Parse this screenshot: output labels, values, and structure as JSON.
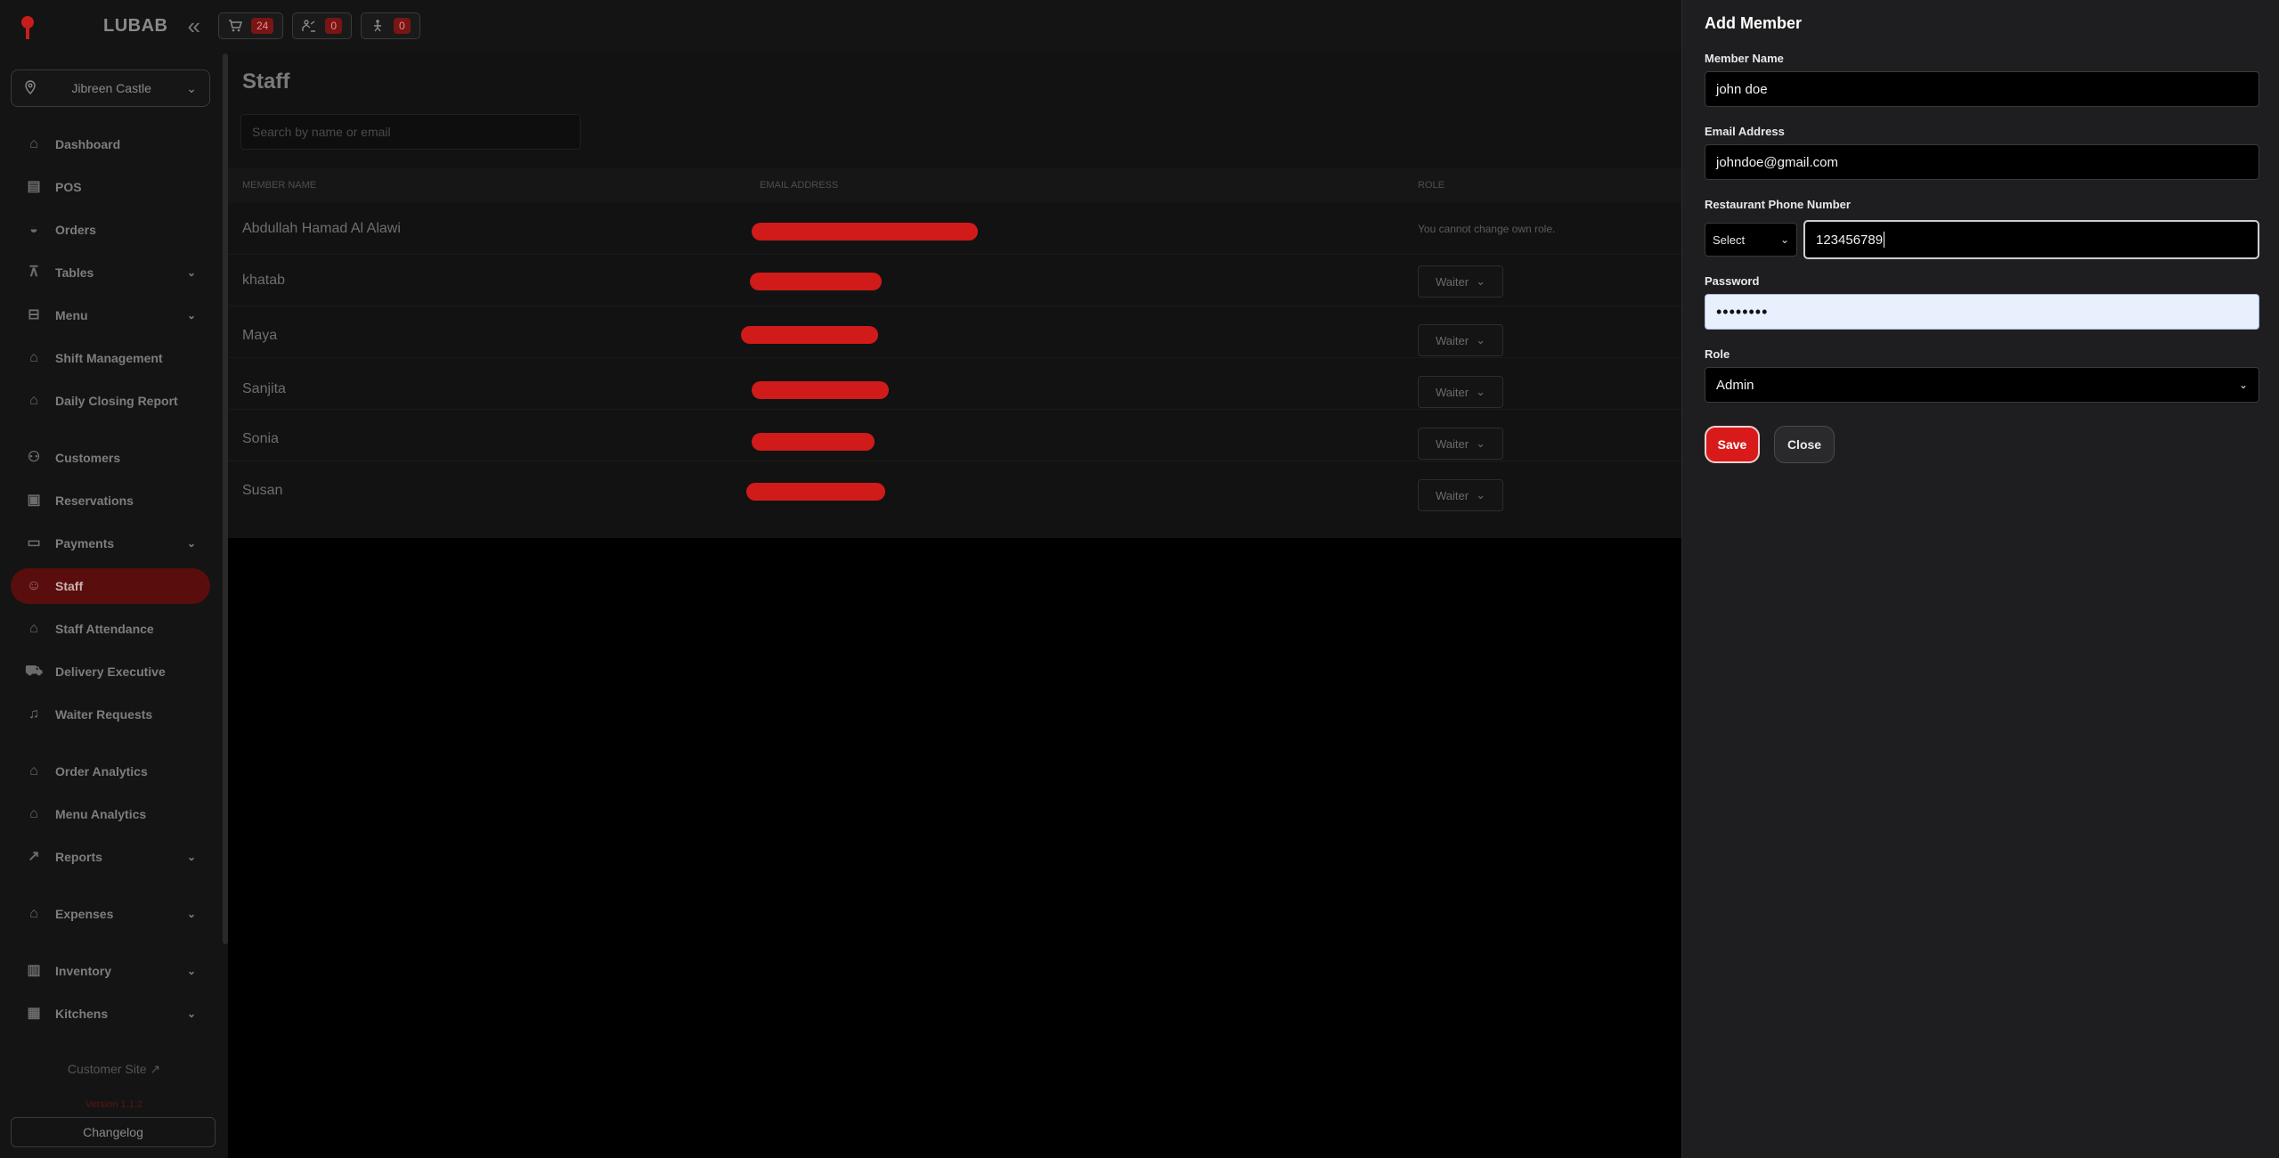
{
  "app": {
    "brand": "LUBAB",
    "collapse_icon": "double-chevron-left-icon",
    "counters": [
      {
        "icon": "cart-icon",
        "count": "24"
      },
      {
        "icon": "waiter-icon",
        "count": "0"
      },
      {
        "icon": "delivery-icon",
        "count": "0"
      }
    ]
  },
  "sidebar": {
    "location": "Jibreen Castle",
    "items": [
      {
        "label": "Dashboard",
        "icon": "home-icon"
      },
      {
        "label": "POS",
        "icon": "pos-icon"
      },
      {
        "label": "Orders",
        "icon": "orders-icon"
      },
      {
        "label": "Tables",
        "icon": "tables-icon"
      },
      {
        "label": "Menu",
        "icon": "menu-icon"
      },
      {
        "label": "Shift Management",
        "icon": "home-icon"
      },
      {
        "label": "Daily Closing Report",
        "icon": "home-icon"
      },
      {
        "label": "Customers",
        "icon": "customers-icon"
      },
      {
        "label": "Reservations",
        "icon": "calendar-icon"
      },
      {
        "label": "Payments",
        "icon": "wallet-icon"
      },
      {
        "label": "Staff",
        "icon": "user-icon"
      },
      {
        "label": "Staff Attendance",
        "icon": "home-icon"
      },
      {
        "label": "Delivery Executive",
        "icon": "scooter-icon"
      },
      {
        "label": "Waiter Requests",
        "icon": "bell-icon"
      },
      {
        "label": "Order Analytics",
        "icon": "home-icon"
      },
      {
        "label": "Menu Analytics",
        "icon": "home-icon"
      },
      {
        "label": "Reports",
        "icon": "chart-line-icon"
      },
      {
        "label": "Expenses",
        "icon": "home-icon"
      },
      {
        "label": "Inventory",
        "icon": "inventory-icon"
      },
      {
        "label": "Kitchens",
        "icon": "kitchen-icon"
      }
    ],
    "customer_site": "Customer Site",
    "version": "Version 1.1.2",
    "changelog": "Changelog"
  },
  "main": {
    "title": "Staff",
    "search_placeholder": "Search by name or email",
    "columns": {
      "name": "MEMBER NAME",
      "email": "EMAIL ADDRESS",
      "role": "ROLE"
    },
    "rows": [
      {
        "name": "Abdullah Hamad Al Alawi",
        "role": "You cannot change own role."
      },
      {
        "name": "khatab",
        "role": "Waiter"
      },
      {
        "name": "Maya",
        "role": "Waiter"
      },
      {
        "name": "Sanjita",
        "role": "Waiter"
      },
      {
        "name": "Sonia",
        "role": "Waiter"
      },
      {
        "name": "Susan",
        "role": "Waiter"
      }
    ]
  },
  "drawer": {
    "title": "Add Member",
    "member_name_label": "Member Name",
    "member_name_value": "john doe",
    "email_label": "Email Address",
    "email_value": "johndoe@gmail.com",
    "phone_label": "Restaurant Phone Number",
    "phone_code": "Select",
    "phone_value": "123456789",
    "password_label": "Password",
    "password_value": "••••••••",
    "role_label": "Role",
    "role_value": "Admin",
    "save_label": "Save",
    "close_label": "Close"
  }
}
